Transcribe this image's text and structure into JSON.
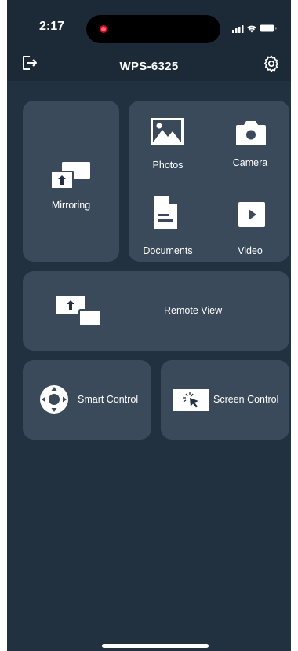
{
  "status_bar": {
    "time": "2:17"
  },
  "header": {
    "title": "WPS-6325",
    "exit_icon": "exit-icon",
    "settings_icon": "gear-icon"
  },
  "tiles": {
    "mirroring": {
      "label": "Mirroring",
      "icon": "mirroring-icon"
    },
    "photos": {
      "label": "Photos",
      "icon": "photo-icon"
    },
    "camera": {
      "label": "Camera",
      "icon": "camera-icon"
    },
    "documents": {
      "label": "Documents",
      "icon": "document-icon"
    },
    "video": {
      "label": "Video",
      "icon": "play-icon"
    },
    "remote_view": {
      "label": "Remote View",
      "icon": "remote-view-icon"
    },
    "smart_control": {
      "label": "Smart Control",
      "icon": "dpad-icon"
    },
    "screen_control": {
      "label": "Screen Control",
      "icon": "cursor-click-icon"
    }
  },
  "colors": {
    "background": "#223140",
    "header": "#1c2a38",
    "tile": "#3a4a5a",
    "record": "#c8102e"
  }
}
